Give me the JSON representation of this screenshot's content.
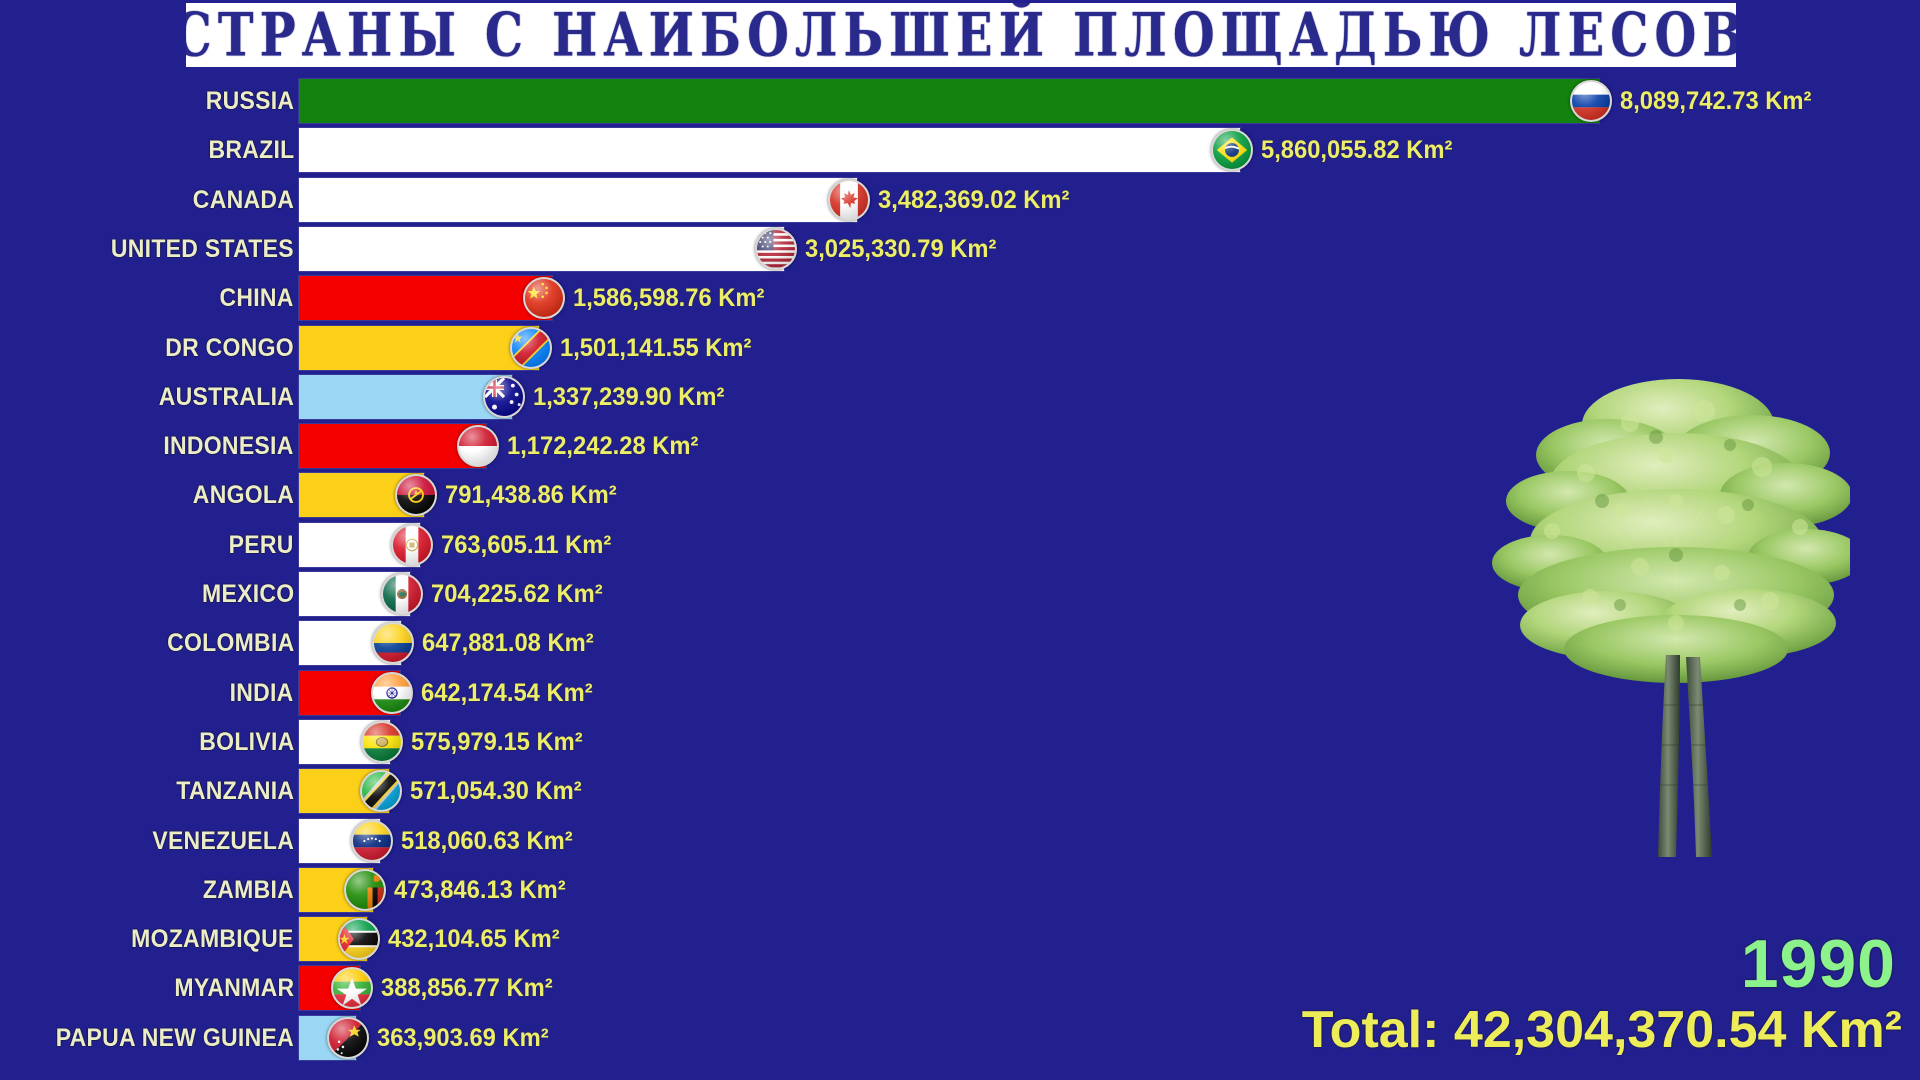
{
  "header": {
    "title": "СТРАНЫ С НАИБОЛЬШЕЙ ПЛОЩАДЬЮ ЛЕСОВ"
  },
  "footer": {
    "year": "1990",
    "total": "Total: 42,304,370.54 Km²"
  },
  "colors": {
    "background": "#221f8f",
    "title_box": "#ffffff",
    "title_text": "#2a2a8c",
    "label_text": "#ecedc6",
    "value_text": "#ecee6a",
    "year_text": "#8cf28c",
    "total_text": "#eded5a",
    "bar_green": "#14820e",
    "bar_white": "#ffffff",
    "bar_red": "#f40000",
    "bar_gold": "#fcd018",
    "bar_lightblue": "#9ad7f4"
  },
  "chart_data": {
    "type": "bar",
    "orientation": "horizontal",
    "title": "СТРАНЫ С НАИБОЛЬШЕЙ ПЛОЩАДЬЮ ЛЕСОВ",
    "xlabel": "",
    "ylabel": "",
    "unit": "Km²",
    "grid": false,
    "legend": false,
    "xlim": [
      0,
      8089742.73
    ],
    "year": "1990",
    "total": 42304370.54,
    "categories": [
      "RUSSIA",
      "BRAZIL",
      "CANADA",
      "UNITED STATES",
      "CHINA",
      "DR CONGO",
      "AUSTRALIA",
      "INDONESIA",
      "ANGOLA",
      "PERU",
      "MEXICO",
      "COLOMBIA",
      "INDIA",
      "BOLIVIA",
      "TANZANIA",
      "VENEZUELA",
      "ZAMBIA",
      "MOZAMBIQUE",
      "MYANMAR",
      "PAPUA NEW GUINEA"
    ],
    "values": [
      8089742.73,
      5860055.82,
      3482369.02,
      3025330.79,
      1586598.76,
      1501141.55,
      1337239.9,
      1172242.28,
      791438.86,
      763605.11,
      704225.62,
      647881.08,
      642174.54,
      575979.15,
      571054.3,
      518060.63,
      473846.13,
      432104.65,
      388856.77,
      363903.69
    ],
    "value_labels": [
      "8,089,742.73 Km²",
      "5,860,055.82 Km²",
      "3,482,369.02 Km²",
      "3,025,330.79 Km²",
      "1,586,598.76 Km²",
      "1,501,141.55 Km²",
      "1,337,239.90 Km²",
      "1,172,242.28 Km²",
      "791,438.86 Km²",
      "763,605.11 Km²",
      "704,225.62 Km²",
      "647,881.08 Km²",
      "642,174.54 Km²",
      "575,979.15 Km²",
      "571,054.30 Km²",
      "518,060.63 Km²",
      "473,846.13 Km²",
      "432,104.65 Km²",
      "388,856.77 Km²",
      "363,903.69 Km²"
    ],
    "bar_colors": [
      "#14820e",
      "#ffffff",
      "#ffffff",
      "#ffffff",
      "#f40000",
      "#fcd018",
      "#9ad7f4",
      "#f40000",
      "#fcd018",
      "#ffffff",
      "#ffffff",
      "#ffffff",
      "#f40000",
      "#ffffff",
      "#fcd018",
      "#ffffff",
      "#fcd018",
      "#fcd018",
      "#f40000",
      "#9ad7f4"
    ],
    "flags": [
      "russia",
      "brazil",
      "canada",
      "united-states",
      "china",
      "dr-congo",
      "australia",
      "indonesia",
      "angola",
      "peru",
      "mexico",
      "colombia",
      "india",
      "bolivia",
      "tanzania",
      "venezuela",
      "zambia",
      "mozambique",
      "myanmar",
      "papua-new-guinea"
    ]
  },
  "decoration": {
    "tree": "tree-image"
  }
}
